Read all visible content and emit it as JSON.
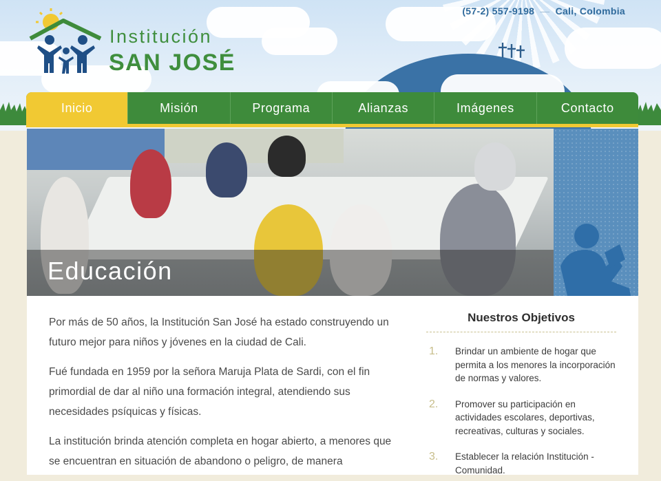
{
  "header": {
    "phone": "(57-2) 557-9198",
    "separator": "—",
    "city": "Cali, Colombia",
    "logo_line1": "Institución",
    "logo_line2": "SAN JOSÉ"
  },
  "nav": {
    "items": [
      {
        "label": "Inicio",
        "active": true
      },
      {
        "label": "Misión"
      },
      {
        "label": "Programa"
      },
      {
        "label": "Alianzas"
      },
      {
        "label": "Imágenes"
      },
      {
        "label": "Contacto"
      }
    ]
  },
  "hero": {
    "title": "Educación"
  },
  "main": {
    "paragraphs": [
      "Por más de 50 años, la Institución San José ha estado construyendo un futuro mejor para niños y jóvenes en la ciudad de Cali.",
      "Fué fundada en 1959 por la señora Maruja Plata de Sardi, con el fin primordial de dar al niño una formación integral, atendiendo sus necesidades psíquicas y físicas.",
      "La institución brinda atención completa en hogar abierto, a menores que se encuentran en situación de abandono o peligro, de manera"
    ]
  },
  "aside": {
    "title": "Nuestros Objetivos",
    "objectives": [
      {
        "num": "1.",
        "text": "Brindar un ambiente de hogar que permita a los menores la incorporación de normas y valores."
      },
      {
        "num": "2.",
        "text": "Promover su participación en actividades escolares, deportivas, recreativas, culturas y sociales."
      },
      {
        "num": "3.",
        "text": "Establecer la relación Institución - Comunidad."
      }
    ]
  },
  "colors": {
    "brand_green": "#3e8b3b",
    "accent_yellow": "#f1c933",
    "brand_blue": "#2f6a9c"
  }
}
